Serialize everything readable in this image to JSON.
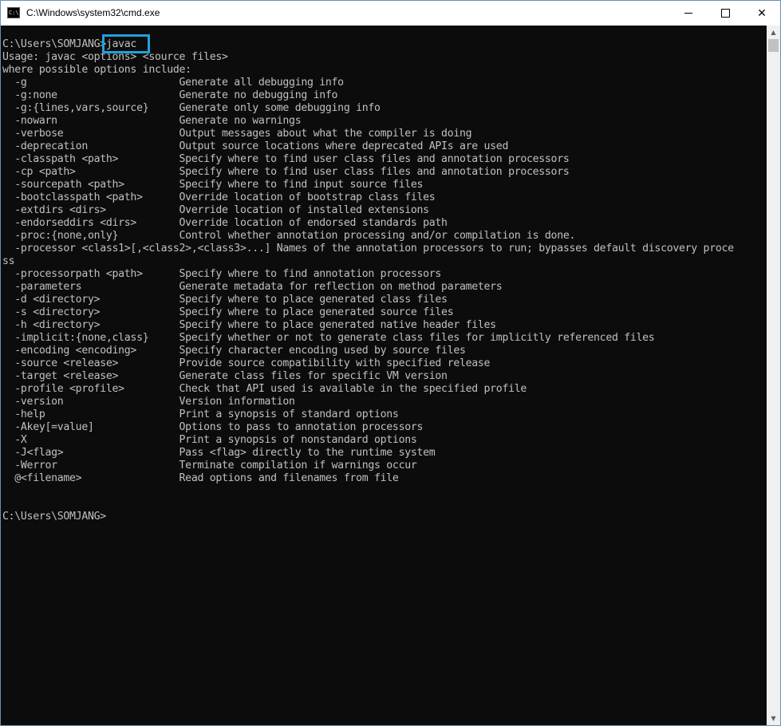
{
  "window": {
    "title": "C:\\Windows\\system32\\cmd.exe",
    "icon": "cmd-icon",
    "icon_text": "C:\\"
  },
  "controls": {
    "minimize": "minimize-icon",
    "maximize": "maximize-icon",
    "close": "close-icon",
    "close_glyph": "✕"
  },
  "console": {
    "lines": [
      "C:\\Users\\SOMJANG>javac",
      "Usage: javac <options> <source files>",
      "where possible options include:",
      "  -g                         Generate all debugging info",
      "  -g:none                    Generate no debugging info",
      "  -g:{lines,vars,source}     Generate only some debugging info",
      "  -nowarn                    Generate no warnings",
      "  -verbose                   Output messages about what the compiler is doing",
      "  -deprecation               Output source locations where deprecated APIs are used",
      "  -classpath <path>          Specify where to find user class files and annotation processors",
      "  -cp <path>                 Specify where to find user class files and annotation processors",
      "  -sourcepath <path>         Specify where to find input source files",
      "  -bootclasspath <path>      Override location of bootstrap class files",
      "  -extdirs <dirs>            Override location of installed extensions",
      "  -endorseddirs <dirs>       Override location of endorsed standards path",
      "  -proc:{none,only}          Control whether annotation processing and/or compilation is done.",
      "  -processor <class1>[,<class2>,<class3>...] Names of the annotation processors to run; bypasses default discovery proce",
      "ss",
      "  -processorpath <path>      Specify where to find annotation processors",
      "  -parameters                Generate metadata for reflection on method parameters",
      "  -d <directory>             Specify where to place generated class files",
      "  -s <directory>             Specify where to place generated source files",
      "  -h <directory>             Specify where to place generated native header files",
      "  -implicit:{none,class}     Specify whether or not to generate class files for implicitly referenced files",
      "  -encoding <encoding>       Specify character encoding used by source files",
      "  -source <release>          Provide source compatibility with specified release",
      "  -target <release>          Generate class files for specific VM version",
      "  -profile <profile>         Check that API used is available in the specified profile",
      "  -version                   Version information",
      "  -help                      Print a synopsis of standard options",
      "  -Akey[=value]              Options to pass to annotation processors",
      "  -X                         Print a synopsis of nonstandard options",
      "  -J<flag>                   Pass <flag> directly to the runtime system",
      "  -Werror                    Terminate compilation if warnings occur",
      "  @<filename>                Read options and filenames from file",
      "",
      "",
      "C:\\Users\\SOMJANG>"
    ]
  },
  "scrollbar": {
    "up": "scroll-up-arrow-icon",
    "down": "scroll-down-arrow-icon",
    "up_glyph": "▲",
    "down_glyph": "▼"
  },
  "colors": {
    "background": "#0c0c0c",
    "text": "#c0c0c0",
    "highlight": "#1fa1e0"
  }
}
